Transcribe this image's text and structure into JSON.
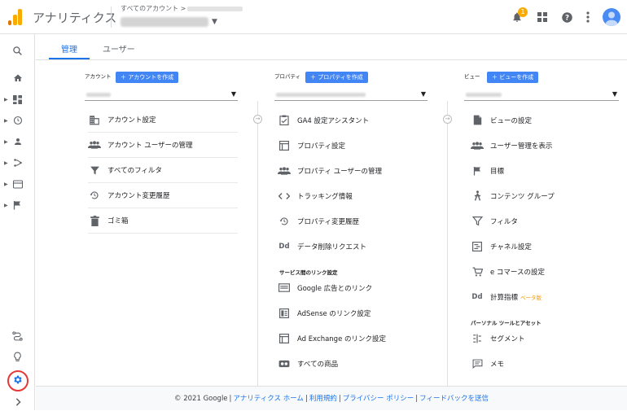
{
  "header": {
    "app_title": "アナリティクス",
    "breadcrumb": "すべてのアカウント >",
    "avatar_color": "#4a8af4",
    "notification_count": "1"
  },
  "sidebar": {
    "icons": [
      "search-icon",
      "home-icon",
      "dashboard-icon",
      "clock-icon",
      "person-icon",
      "acquisition-icon",
      "behavior-icon",
      "flag-icon",
      "attribution-icon",
      "lightbulb-icon",
      "gear-icon",
      "expand-icon"
    ]
  },
  "tabs": {
    "admin": "管理",
    "user": "ユーザー"
  },
  "account": {
    "heading": "アカウント",
    "create": "＋ アカウントを作成",
    "items": [
      "アカウント設定",
      "アカウント ユーザーの管理",
      "すべてのフィルタ",
      "アカウント変更履歴",
      "ゴミ箱"
    ]
  },
  "property": {
    "heading": "プロパティ",
    "create": "＋ プロパティを作成",
    "items": [
      "GA4 設定アシスタント",
      "プロパティ設定",
      "プロパティ ユーザーの管理",
      "トラッキング情報",
      "プロパティ変更履歴",
      "データ削除リクエスト"
    ],
    "section_links": "サービス間のリンク設定",
    "links": [
      "Google 広告とのリンク",
      "AdSense のリンク設定",
      "Ad Exchange のリンク設定",
      "すべての商品"
    ]
  },
  "view": {
    "heading": "ビュー",
    "create": "＋ ビューを作成",
    "items": [
      "ビューの設定",
      "ユーザー管理を表示",
      "目標",
      "コンテンツ グループ",
      "フィルタ",
      "チャネル設定",
      "e コマースの設定",
      "計算指標"
    ],
    "beta": "ベータ版",
    "section_tools": "パーソナル ツールとアセット",
    "tools": [
      "セグメント",
      "メモ"
    ]
  },
  "footer": {
    "copyright": "© 2021 Google",
    "links": [
      "アナリティクス ホーム",
      "利用規約",
      "プライバシー ポリシー",
      "フィードバックを送信"
    ]
  }
}
